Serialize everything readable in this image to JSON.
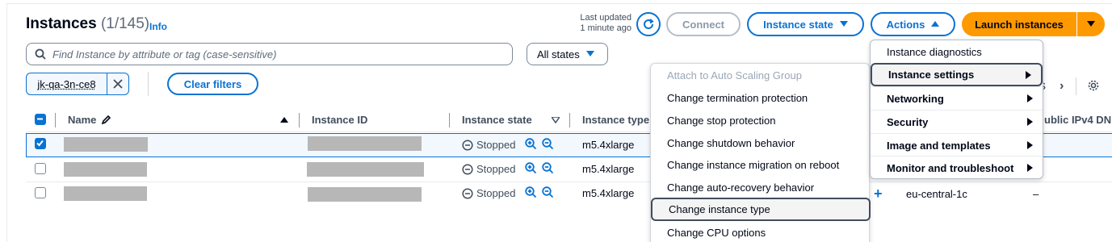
{
  "header": {
    "title": "Instances",
    "count": "(1/145)",
    "info": "Info",
    "last_updated_line1": "Last updated",
    "last_updated_line2": "1 minute ago"
  },
  "toolbar": {
    "connect": "Connect",
    "instance_state": "Instance state",
    "actions": "Actions",
    "launch": "Launch instances"
  },
  "filters": {
    "search_placeholder": "Find Instance by attribute or tag (case-sensitive)",
    "states": "All states",
    "token": "jk-qa-3n-ce8",
    "clear": "Clear filters"
  },
  "table": {
    "headers": {
      "name": "Name",
      "instance_id": "Instance ID",
      "instance_state": "Instance state",
      "instance_type": "Instance type",
      "public_ipv4": "ublic IPv4 DN"
    },
    "rows": [
      {
        "state": "Stopped",
        "type": "m5.4xlarge",
        "selected": true
      },
      {
        "state": "Stopped",
        "type": "m5.4xlarge",
        "selected": false
      },
      {
        "state": "Stopped",
        "type": "m5.4xlarge",
        "selected": false,
        "az": "eu-central-1c",
        "public": "–"
      }
    ]
  },
  "actions_menu": {
    "items": [
      {
        "label": "Instance diagnostics",
        "submenu": false
      },
      {
        "label": "Instance settings",
        "submenu": true
      },
      {
        "label": "Networking",
        "submenu": true
      },
      {
        "label": "Security",
        "submenu": true
      },
      {
        "label": "Image and templates",
        "submenu": true
      },
      {
        "label": "Monitor and troubleshoot",
        "submenu": true
      }
    ]
  },
  "settings_submenu": {
    "items": [
      {
        "label": "Attach to Auto Scaling Group",
        "disabled": true
      },
      {
        "label": "Change termination protection"
      },
      {
        "label": "Change stop protection"
      },
      {
        "label": "Change shutdown behavior"
      },
      {
        "label": "Change instance migration on reboot"
      },
      {
        "label": "Change auto-recovery behavior"
      },
      {
        "label": "Change instance type"
      },
      {
        "label": "Change CPU options"
      }
    ]
  },
  "colors": {
    "accent": "#0972d3",
    "launch": "#ff9900",
    "text": "#000716",
    "muted": "#414d5c"
  }
}
